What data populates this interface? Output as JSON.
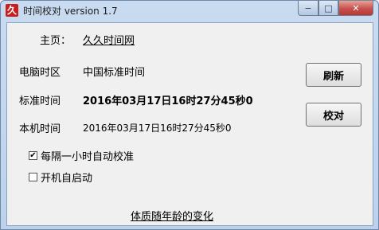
{
  "window": {
    "title": "时间校对 version 1.7",
    "icon_glyph": "久",
    "min_glyph": "−",
    "max_glyph": "□",
    "close_glyph": "✕"
  },
  "homepage": {
    "label": "主页：",
    "link_text": "久久时间网"
  },
  "pc_timezone": {
    "label": "电脑时区",
    "value": "中国标准时间"
  },
  "standard_time": {
    "label": "标准时间",
    "value": "2016年03月17日16时27分45秒0"
  },
  "local_time": {
    "label": "本机时间",
    "value": "2016年03月17日16时27分45秒0"
  },
  "buttons": {
    "refresh": "刷新",
    "calibrate": "校对"
  },
  "options": {
    "hourly_sync": {
      "label": "每隔一小时自动校准",
      "checked": true,
      "check_glyph": "✔"
    },
    "autostart": {
      "label": "开机自启动",
      "checked": false,
      "check_glyph": ""
    }
  },
  "footer_link": "体质随年龄的变化"
}
